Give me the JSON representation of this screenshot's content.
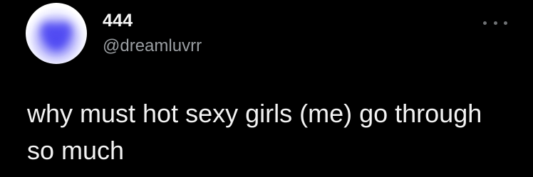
{
  "author": {
    "display_name": "444",
    "handle": "@dreamluvrr",
    "avatar_icon": "blue-heart-avatar-icon",
    "avatar_colors": {
      "center": "#5a55f4",
      "edge": "#ffffff"
    }
  },
  "menu": {
    "icon": "more-options-icon"
  },
  "tweet": {
    "text": "why must hot sexy girls (me) go through\nso much"
  },
  "colors": {
    "background": "#000000",
    "text_primary": "#f2f2f2",
    "text_secondary": "#9a9ea2"
  }
}
